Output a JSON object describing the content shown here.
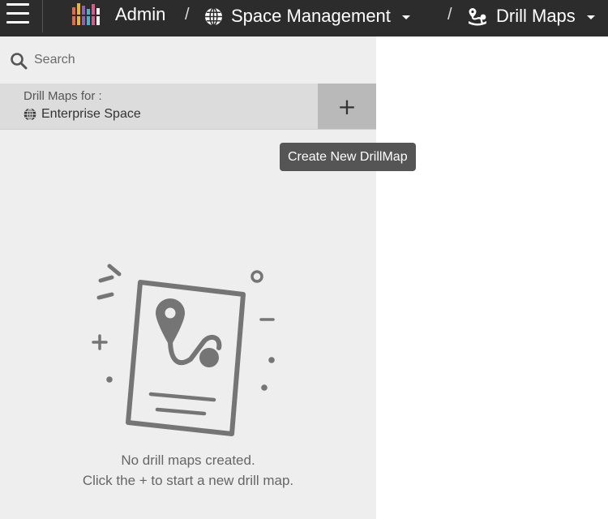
{
  "topbar": {
    "admin_label": "Admin",
    "separator": "/",
    "space_label": "Space Management",
    "drill_label": "Drill Maps",
    "icons": {
      "menu": "hamburger-menu-icon",
      "logo": "app-logo-icon",
      "space": "globe-icon",
      "drill": "drill-map-icon",
      "caret": "caret-down-icon"
    }
  },
  "search": {
    "placeholder": "Search",
    "value": ""
  },
  "scope": {
    "label": "Drill Maps for :",
    "name": "Enterprise Space",
    "add_label": "+"
  },
  "tooltip": {
    "text": "Create New DrillMap"
  },
  "empty_state": {
    "line1": "No drill maps created.",
    "line2": "Click the + to start a new drill map."
  },
  "colors": {
    "topbar_bg": "#2c2c2c",
    "panel_bg": "#eeeeee",
    "header_bg": "#dcdcdc",
    "add_button_bg": "#b9b9b9",
    "tooltip_bg": "#555555",
    "illustration": "#757575"
  }
}
